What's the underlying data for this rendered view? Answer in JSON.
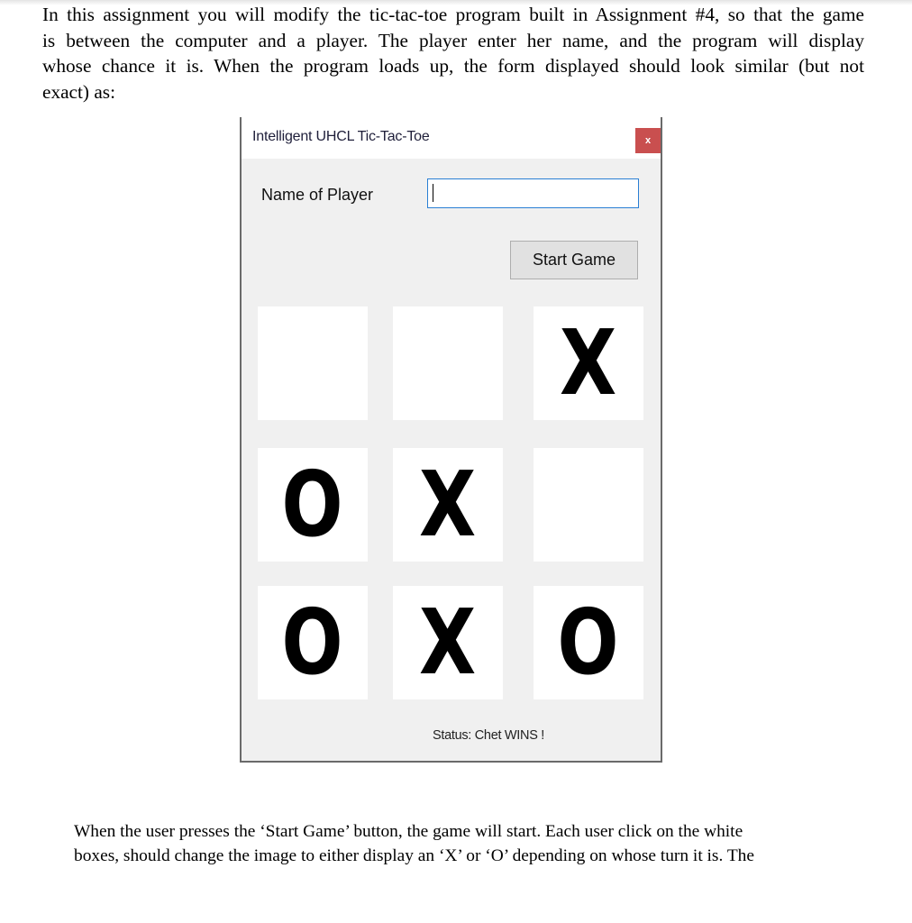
{
  "document": {
    "intro_lines": [
      "In this assignment you will modify the tic-tac-toe program built in Assignment #4, so that the game",
      "is between the computer and a player. The player enter her name, and the program will display",
      "whose chance it is. When the program loads up, the form displayed should look similar (but not",
      "exact) as:"
    ],
    "followup_lines": [
      "When the user presses the ‘Start Game’ button, the game will start. Each user click on the white",
      "boxes, should change the image to either display an ‘X’ or ‘O’ depending on whose turn it is. The"
    ]
  },
  "window": {
    "title": "Intelligent UHCL Tic-Tac-Toe",
    "close_label": "x",
    "close_icon": "close-icon",
    "close_color": "#c94f4f",
    "name_label": "Name of Player",
    "name_value": "",
    "name_placeholder": "",
    "start_button_label": "Start Game",
    "status_text": "Status: Chet WINS !",
    "board": [
      [
        "",
        "",
        "X"
      ],
      [
        "O",
        "X",
        ""
      ],
      [
        "O",
        "X",
        "O"
      ]
    ]
  }
}
